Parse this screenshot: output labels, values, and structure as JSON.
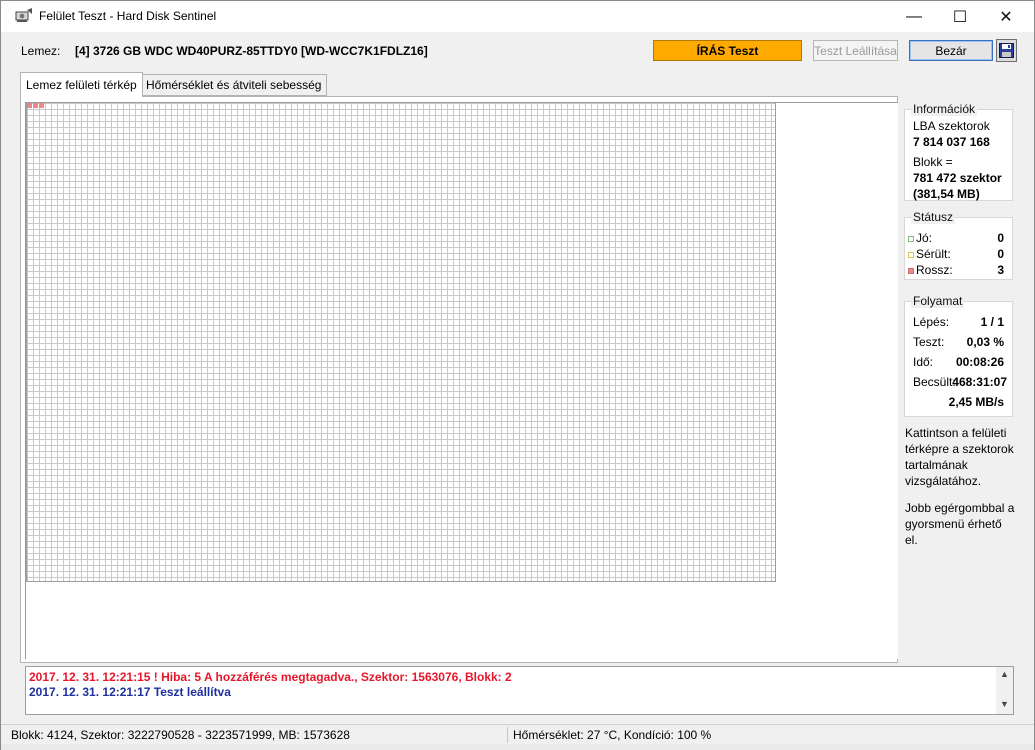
{
  "window": {
    "title": "Felület Teszt - Hard Disk Sentinel",
    "min_icon": "minimize-icon",
    "max_icon": "maximize-icon",
    "close_icon": "close-icon"
  },
  "header": {
    "disk_label": "Lemez:",
    "disk_value": "[4] 3726 GB  WDC WD40PURZ-85TTDY0 [WD-WCC7K1FDLZ16]",
    "write_test": "ÍRÁS Teszt",
    "stop_test": "Teszt Leállítása",
    "close": "Bezár",
    "save_icon": "floppy-disk-icon"
  },
  "colors": {
    "write_test_bg": "#ffaa00",
    "good": "#9fd49f",
    "damaged": "#f3e59a",
    "bad": "#e98989",
    "error_text": "#e8162a",
    "info_text": "#1e2f9e"
  },
  "tabs": [
    {
      "label": "Lemez felületi térkép",
      "active": true
    },
    {
      "label": "Hőmérséklet és átviteli sebesség",
      "active": false
    }
  ],
  "info": {
    "title": "Információk",
    "lba_label": "LBA szektorok",
    "lba_value": "7 814 037 168",
    "block_label": "Blokk =",
    "block_value": "781 472 szektor",
    "block_size": "(381,54 MB)"
  },
  "status": {
    "title": "Státusz",
    "good_label": "Jó:",
    "good_value": "0",
    "damaged_label": "Sérült:",
    "damaged_value": "0",
    "bad_label": "Rossz:",
    "bad_value": "3"
  },
  "progress": {
    "title": "Folyamat",
    "step_label": "Lépés:",
    "step_value": "1 / 1",
    "test_label": "Teszt:",
    "test_value": "0,03 %",
    "time_label": "Idő:",
    "time_value": "00:08:26",
    "est_label": "Becsült:",
    "est_value": "468:31:07",
    "speed": "2,45 MB/s"
  },
  "help": {
    "click": [
      "Kattintson a felületi",
      "térképre a szektorok",
      "tartalmának",
      "vizsgálatához."
    ],
    "right": [
      "Jobb egérgombbal a",
      "gyorsmenü érhető",
      "el."
    ]
  },
  "log": [
    {
      "text": "2017. 12. 31.  12:21:15 ! Hiba: 5 A hozzáférés megtagadva., Szektor: 1563076, Blokk: 2"
    },
    {
      "text": "2017. 12. 31.  12:21:17   Teszt leállítva"
    }
  ],
  "statusbar": {
    "left": "Blokk: 4124, Szektor: 3222790528 - 3223571999, MB: 1573628",
    "right": "Hőmérséklet: 27  °C,  Kondíció: 100 %"
  }
}
